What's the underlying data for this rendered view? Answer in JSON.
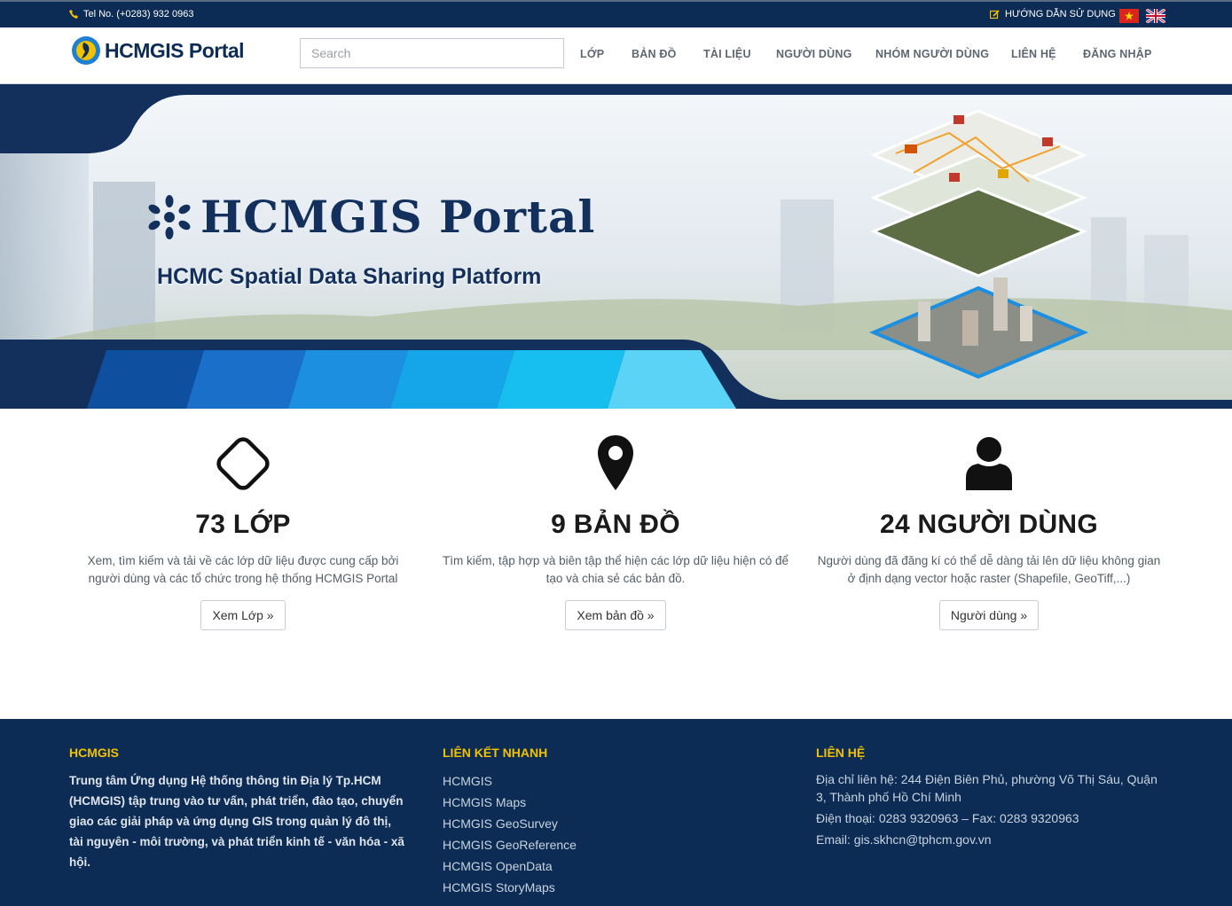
{
  "topbar": {
    "tel": "Tel No. (+0283) 932 0963",
    "guide": "HƯỚNG DẪN SỬ DỤNG"
  },
  "brand": {
    "name": "HCMGIS Portal"
  },
  "search": {
    "placeholder": "Search"
  },
  "nav": {
    "items": [
      "LỚP",
      "BẢN ĐỒ",
      "TÀI LIỆU",
      "NGƯỜI DÙNG",
      "NHÓM NGƯỜI DÙNG",
      "LIÊN HỆ",
      "ĐĂNG NHẬP"
    ]
  },
  "hero": {
    "title": "HCMGIS Portal",
    "subtitle": "HCMC Spatial Data Sharing Platform"
  },
  "stats": [
    {
      "title": "73 LỚP",
      "desc": "Xem, tìm kiếm và tải về các lớp dữ liệu được cung cấp bởi người dùng và các tổ chức trong hệ thống HCMGIS Portal",
      "button": "Xem Lớp »",
      "icon": "diamond-icon"
    },
    {
      "title": "9 BẢN ĐỒ",
      "desc": "Tìm kiếm, tập hợp và biên tập thể hiện các lớp dữ liệu hiện có để tạo và chia sẻ các bản đồ.",
      "button": "Xem bản đồ »",
      "icon": "map-marker-icon"
    },
    {
      "title": "24 NGƯỜI DÙNG",
      "desc": "Người dùng đã đăng kí có thể dễ dàng tải lên dữ liệu không gian ở định dạng vector hoặc raster (Shapefile, GeoTiff,...)",
      "button": "Người dùng »",
      "icon": "user-icon"
    }
  ],
  "footer": {
    "col1": {
      "heading": "HCMGIS",
      "text": "Trung tâm Ứng dụng Hệ thống thông tin Địa lý Tp.HCM (HCMGIS) tập trung vào tư vấn, phát triển, đào tạo, chuyển giao các giải pháp và ứng dụng GIS trong quản lý đô thị, tài nguyên - môi trường, và phát triển kinh tế - văn hóa - xã hội."
    },
    "col2": {
      "heading": "LIÊN KẾT NHANH",
      "links": [
        "HCMGIS",
        "HCMGIS Maps",
        "HCMGIS GeoSurvey",
        "HCMGIS GeoReference",
        "HCMGIS OpenData",
        "HCMGIS StoryMaps"
      ]
    },
    "col3": {
      "heading": "LIÊN HỆ",
      "address": "Địa chỉ liên hệ: 244 Điện Biên Phủ, phường Võ Thị Sáu, Quận 3, Thành phố Hồ Chí Minh",
      "phone": "Điện thoại: 0283 9320963 – Fax: 0283 9320963",
      "email": "Email: gis.skhcn@tphcm.gov.vn"
    }
  },
  "colors": {
    "navy": "#0c2c55",
    "accent_yellow": "#f2c200",
    "hero_blue": "#1c8fd8"
  }
}
